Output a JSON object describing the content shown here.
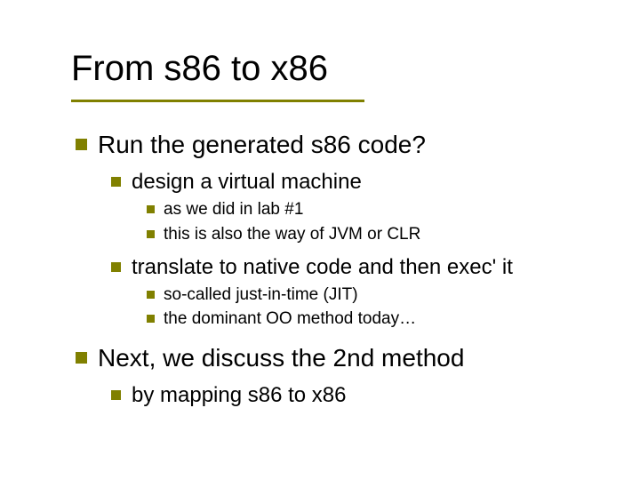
{
  "title": "From s86 to x86",
  "bullets": {
    "p1": "Run the generated s86 code?",
    "p1a": "design a virtual machine",
    "p1a1": "as we did in lab #1",
    "p1a2": "this is also the way of JVM or CLR",
    "p1b": "translate to native code and then exec' it",
    "p1b1": "so-called just-in-time (JIT)",
    "p1b2": "the dominant OO method today…",
    "p2": "Next, we discuss the 2nd method",
    "p2a": "by mapping s86 to x86"
  }
}
